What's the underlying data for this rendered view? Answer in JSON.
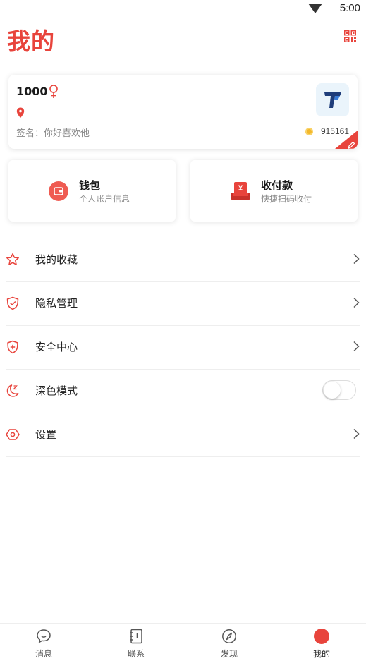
{
  "status_bar": {
    "time": "5:00"
  },
  "header": {
    "title": "我的"
  },
  "profile": {
    "name": "1000",
    "signature": "签名：你好喜欢他",
    "coins": "915161"
  },
  "quick_actions": [
    {
      "title": "钱包",
      "subtitle": "个人账户信息"
    },
    {
      "title": "收付款",
      "subtitle": "快捷扫码收付"
    }
  ],
  "menu": [
    {
      "label": "我的收藏",
      "icon": "star-icon"
    },
    {
      "label": "隐私管理",
      "icon": "shield-heart-icon"
    },
    {
      "label": "安全中心",
      "icon": "shield-plus-icon"
    },
    {
      "label": "深色模式",
      "icon": "moon-icon",
      "toggle": false
    },
    {
      "label": "设置",
      "icon": "gear-icon"
    }
  ],
  "bottom_nav": [
    {
      "label": "消息",
      "icon": "chat-icon"
    },
    {
      "label": "联系",
      "icon": "contacts-book-icon"
    },
    {
      "label": "发现",
      "icon": "compass-icon"
    },
    {
      "label": "我的",
      "icon": "user-icon",
      "active": true
    }
  ],
  "colors": {
    "accent": "#e8443c",
    "text": "#222222",
    "muted": "#888888"
  }
}
